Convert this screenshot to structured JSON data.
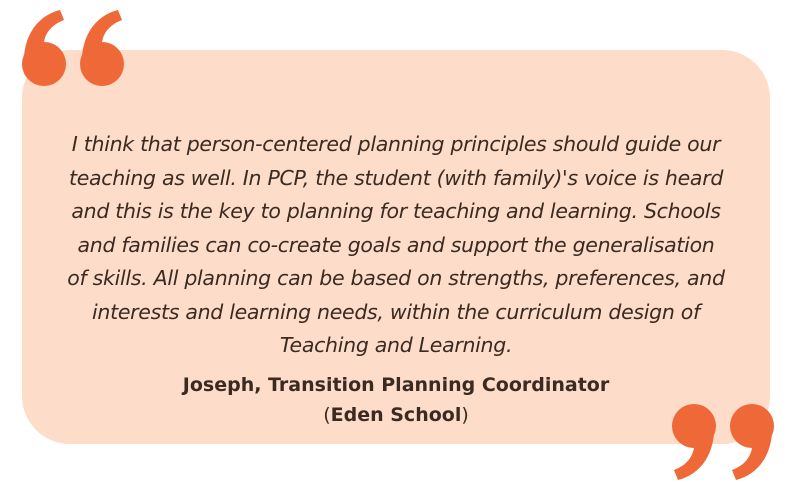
{
  "quote": {
    "text": "I think that person-centered planning principles should guide our teaching as well. In PCP, the student (with family)'s voice is heard and this is the key to planning for teaching and learning. Schools and families can co-create goals and support the generalisation of skills. All planning can be based on strengths, preferences, and interests and learning needs, within the curriculum design of Teaching and Learning.",
    "lines": [
      "I think that person-centered planning principles should guide our",
      "teaching as well. In PCP, the student (with family)'s voice is heard",
      "and this is the key to planning for teaching and learning. Schools",
      "and families can co-create goals and support the generalisation",
      "of skills. All planning can be based on strengths, preferences, and",
      "interests and learning needs, within the curriculum design of",
      "Teaching and Learning."
    ]
  },
  "attribution": {
    "name_role": "Joseph, Transition Planning Coordinator",
    "open_paren": "(",
    "school": "Eden School",
    "close_paren": ")"
  },
  "colors": {
    "card_background": "#fddcc9",
    "quote_mark": "#ee6838",
    "text": "#3a2a22"
  },
  "icons": {
    "open_quote": "open-quote-icon",
    "close_quote": "close-quote-icon"
  }
}
